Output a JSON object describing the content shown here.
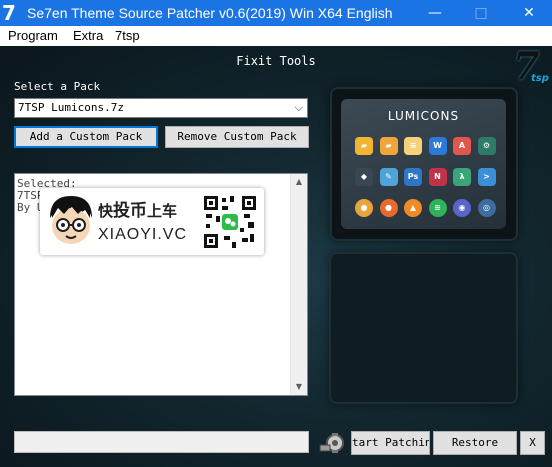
{
  "window": {
    "logo": "7",
    "title": "Se7en Theme Source Patcher v0.6(2019) Win X64 English",
    "controls": {
      "minimize": "—",
      "maximize": "□",
      "close": "✕"
    }
  },
  "menu": [
    "Program",
    "Extra",
    "7tsp"
  ],
  "panel_title": "Fixit Tools",
  "brand": {
    "big": "7",
    "small": "tsp"
  },
  "pack": {
    "label": "Select a Pack",
    "selected": "7TSP Lumicons.7z",
    "add_label": "Add a Custom Pack",
    "remove_label": "Remove Custom Pack"
  },
  "details": {
    "lines": [
      "Selected:",
      "7TSP",
      "By U"
    ]
  },
  "preview": {
    "title": "LUMICONS",
    "icons": [
      {
        "name": "folder-icon",
        "glyph": "▰",
        "color": "#f2b533"
      },
      {
        "name": "folder-docs-icon",
        "glyph": "▰",
        "color": "#f0a53a"
      },
      {
        "name": "document-icon",
        "glyph": "≡",
        "color": "#f7d17a"
      },
      {
        "name": "word-icon",
        "glyph": "W",
        "color": "#2b79d9"
      },
      {
        "name": "pdf-icon",
        "glyph": "A",
        "color": "#e2574c"
      },
      {
        "name": "settings-icon",
        "glyph": "⚙",
        "color": "#2e7b6a"
      },
      {
        "name": "inkscape-icon",
        "glyph": "◆",
        "color": "#3a4653"
      },
      {
        "name": "paint-icon",
        "glyph": "✎",
        "color": "#4ea3d8"
      },
      {
        "name": "photoshop-icon",
        "glyph": "Ps",
        "color": "#2f77c4"
      },
      {
        "name": "onenote-icon",
        "glyph": "N",
        "color": "#c0344a"
      },
      {
        "name": "lambda-icon",
        "glyph": "λ",
        "color": "#3aa678"
      },
      {
        "name": "terminal-icon",
        "glyph": ">",
        "color": "#3a8fd9"
      },
      {
        "name": "chrome-icon",
        "glyph": "●",
        "color": "#e8a33a"
      },
      {
        "name": "firefox-icon",
        "glyph": "●",
        "color": "#e86a2c"
      },
      {
        "name": "vlc-icon",
        "glyph": "▲",
        "color": "#f08a24"
      },
      {
        "name": "spotify-icon",
        "glyph": "≋",
        "color": "#2fb25a"
      },
      {
        "name": "discord-icon",
        "glyph": "◉",
        "color": "#5865c9"
      },
      {
        "name": "steam-icon",
        "glyph": "◎",
        "color": "#3c6d9e"
      }
    ]
  },
  "footer": {
    "start_label": "tart Patchin",
    "restore_label": "Restore",
    "x_label": "X"
  },
  "watermark": {
    "cn_prefix": "快",
    "cn_big": "投币",
    "cn_suffix": "上车",
    "en": "XIAOYI.VC"
  }
}
